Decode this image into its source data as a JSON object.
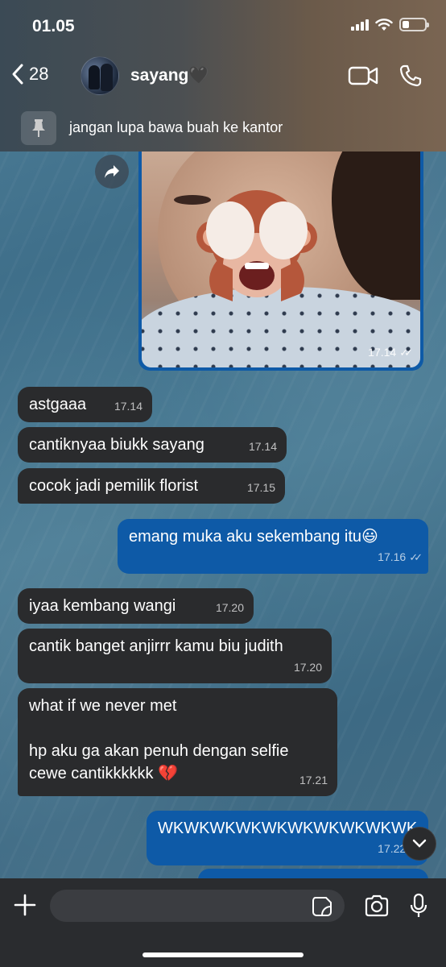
{
  "status": {
    "time": "01.05"
  },
  "header": {
    "back_count": "28",
    "contact_name": "sayang🖤"
  },
  "pinned": {
    "text": "jangan lupa bawa buah ke kantor"
  },
  "photo_message": {
    "time": "17.14"
  },
  "messages": [
    {
      "dir": "in",
      "text": "astgaaa",
      "time": "17.14"
    },
    {
      "dir": "in",
      "text": "cantiknyaa biukk sayang",
      "time": "17.14"
    },
    {
      "dir": "in",
      "text": "cocok jadi pemilik florist",
      "time": "17.15"
    },
    {
      "dir": "out",
      "text": "emang muka aku sekembang itu😃",
      "time": "17.16"
    },
    {
      "dir": "in",
      "text": "iyaa kembang wangi",
      "time": "17.20"
    },
    {
      "dir": "in",
      "text": "cantik banget anjirrr kamu biu judith",
      "time": "17.20"
    },
    {
      "dir": "in",
      "text_line1": "what if we never met",
      "text_line2": "hp aku ga akan penuh dengan selfie",
      "text_line3": "cewe cantikkkkkk 💔",
      "time": "17.21"
    },
    {
      "dir": "out",
      "text": "WKWKWKWKWKWKWKWKWKWK",
      "time": "17.22"
    }
  ],
  "input": {
    "placeholder": ""
  },
  "icons": {
    "back": "chevron-left-icon",
    "video": "video-call-icon",
    "phone": "phone-icon",
    "pin": "pin-icon",
    "forward": "forward-icon",
    "scroll": "chevron-down-icon",
    "plus": "plus-icon",
    "sticker": "sticker-icon",
    "camera": "camera-icon",
    "mic": "microphone-icon"
  },
  "colors": {
    "outgoing": "#0e5aa7",
    "incoming": "#2a2b2d",
    "input_bar": "#2a2c2f"
  }
}
